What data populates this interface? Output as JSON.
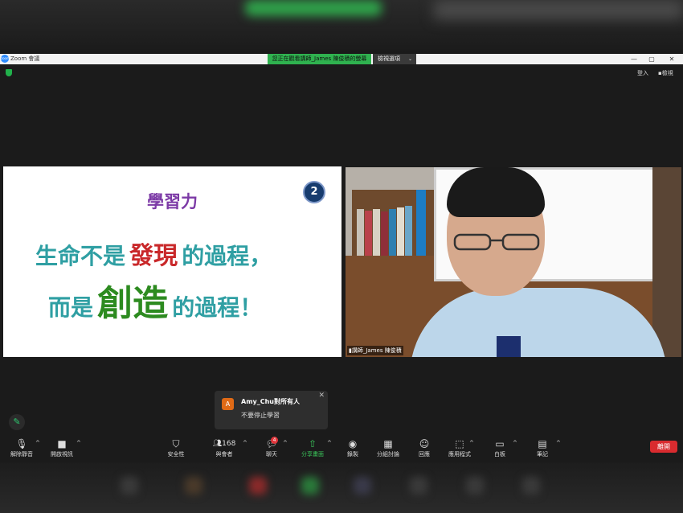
{
  "app": {
    "title": "Zoom 會議",
    "logo_text": "zoom",
    "share_notice": "您正在觀看講師_James 陳俊積的螢幕",
    "view_options": "檢視選項",
    "caret": "⌄",
    "window_controls": [
      "—",
      "▢",
      "✕"
    ]
  },
  "top_right": {
    "signin": "登入",
    "view": "檢視"
  },
  "slide": {
    "title": "學習力",
    "number": "2",
    "line1_a": "生命不是",
    "line1_b": "發現",
    "line1_c": "的過程，",
    "line2_a": "而是",
    "line2_b": "創造",
    "line2_c": "的過程！"
  },
  "video": {
    "label": "講師_James 陳俊積"
  },
  "chat_toast": {
    "avatar": "A",
    "from": "Amy_Chu對所有人",
    "message": "不要停止學習",
    "close": "✕"
  },
  "toolbar": {
    "unmute": "解除靜音",
    "start_video": "開啟視訊",
    "security": "安全性",
    "participants": "與會者",
    "participants_count": "168",
    "chat": "聊天",
    "chat_badge": "4",
    "share": "分享畫面",
    "record": "錄製",
    "breakout": "分組討論",
    "reactions": "回應",
    "apps": "應用程式",
    "whiteboard": "白板",
    "notes": "筆記",
    "leave": "離開",
    "caret": "^"
  },
  "colors": {
    "share_green": "#2fb24f",
    "slide_purple": "#7c3aa6",
    "slide_teal": "#2f9fa3",
    "slide_red": "#c9282a",
    "slide_green": "#2d8b20",
    "leave_red": "#d92b2f"
  },
  "icons": {
    "mic_muted": "mic-muted-icon",
    "video_off": "video-off-icon",
    "shield": "shield-icon",
    "people": "people-icon",
    "chat": "chat-icon",
    "share": "share-screen-icon",
    "record": "record-icon",
    "breakout": "grid-icon",
    "reactions": "emoji-icon",
    "apps": "apps-icon",
    "whiteboard": "whiteboard-icon",
    "notes": "notes-icon",
    "pencil": "pencil-icon"
  }
}
